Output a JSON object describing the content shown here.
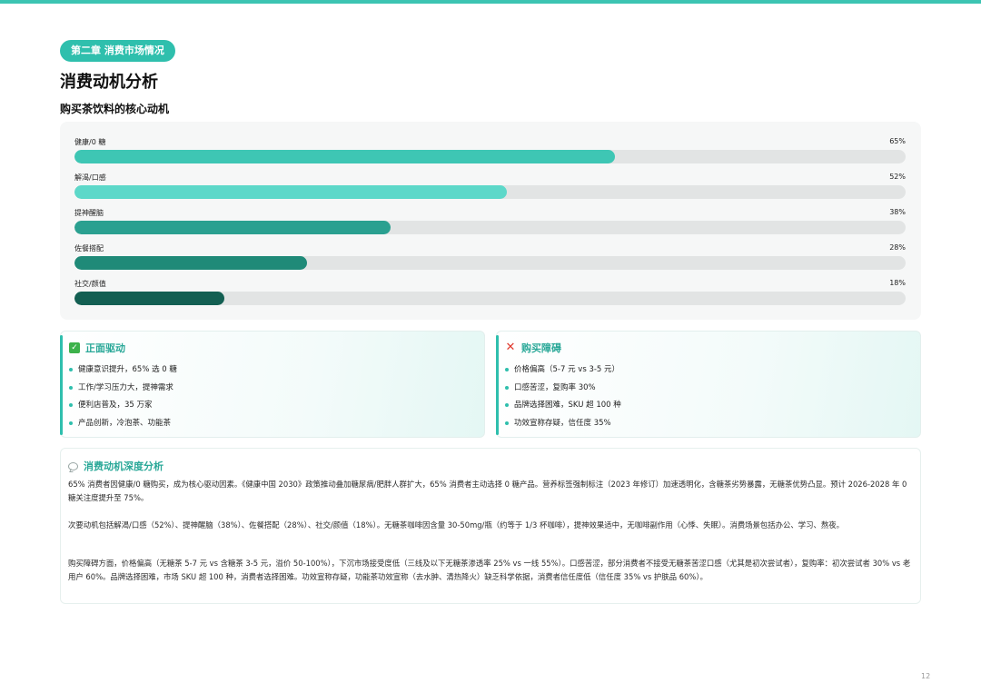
{
  "header": {
    "chapter": "第二章 消费市场情况",
    "title": "消费动机分析",
    "subtitle": "购买茶饮料的核心动机"
  },
  "chart_data": {
    "type": "bar",
    "orientation": "horizontal",
    "categories": [
      "健康/0 糖",
      "解渴/口感",
      "提神醒脑",
      "佐餐搭配",
      "社交/颜值"
    ],
    "values": [
      65,
      52,
      38,
      28,
      18
    ],
    "value_labels": [
      "65%",
      "52%",
      "38%",
      "28%",
      "18%"
    ],
    "colors": [
      "#3ec6b4",
      "#5dd8c9",
      "#2aa090",
      "#1f8a78",
      "#135f52"
    ],
    "xlim": [
      0,
      100
    ],
    "grid": false
  },
  "cards": {
    "positive": {
      "icon": "check-icon",
      "title": "正面驱动",
      "items": [
        "健康意识提升，65% 选 0 糖",
        "工作/学习压力大，提神需求",
        "便利店普及，35 万家",
        "产品创新，冷泡茶、功能茶"
      ]
    },
    "barrier": {
      "icon": "cross-icon",
      "title": "购买障碍",
      "items": [
        "价格偏高（5-7 元 vs 3-5 元）",
        "口感苦涩，复购率 30%",
        "品牌选择困难，SKU 超 100 种",
        "功效宣称存疑，信任度 35%"
      ]
    }
  },
  "analysis": {
    "icon": "speech-bubble-icon",
    "title": "消费动机深度分析",
    "paragraphs": [
      "65% 消费者因健康/0 糖购买，成为核心驱动因素。《健康中国 2030》政策推动叠加糖尿病/肥胖人群扩大，65% 消费者主动选择 0 糖产品。营养标签强制标注（2023 年修订）加速透明化，含糖茶劣势暴露，无糖茶优势凸显。预计 2026-2028 年 0 糖关注度提升至 75%。",
      "次要动机包括解渴/口感（52%）、提神醒脑（38%）、佐餐搭配（28%）、社交/颜值（18%）。无糖茶咖啡因含量 30-50mg/瓶（约等于 1/3 杯咖啡），提神效果适中，无咖啡副作用（心悸、失眠）。消费场景包括办公、学习、熬夜。",
      "购买障碍方面，价格偏高（无糖茶 5-7 元 vs 含糖茶 3-5 元，溢价 50-100%），下沉市场接受度低（三线及以下无糖茶渗透率 25% vs 一线 55%）。口感苦涩，部分消费者不接受无糖茶苦涩口感（尤其是初次尝试者），复购率：初次尝试者 30% vs 老用户 60%。品牌选择困难，市场 SKU 超 100 种，消费者选择困难。功效宣称存疑，功能茶功效宣称（去水肿、清热降火）缺乏科学依据，消费者信任度低（信任度 35% vs 护肤品 60%）。"
    ]
  },
  "footer": {
    "page_number": "12"
  }
}
